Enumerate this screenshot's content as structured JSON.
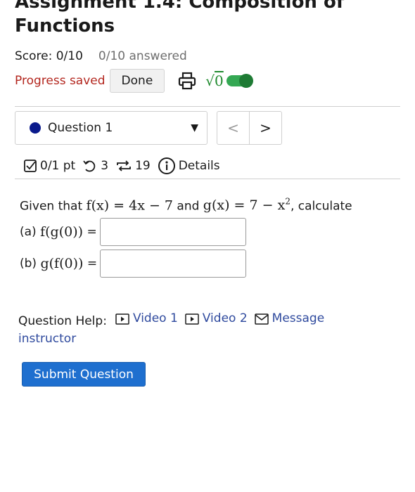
{
  "assignment": {
    "title": "Assignment 1.4: Composition of Functions"
  },
  "score": {
    "label": "Score: 0/10",
    "answered": "0/10 answered"
  },
  "save": {
    "status": "Progress saved",
    "done_label": "Done",
    "sqrt_glyph": "√",
    "sqrt_value": "0"
  },
  "question_nav": {
    "selected": "Question 1",
    "prev": "<",
    "next": ">"
  },
  "meta": {
    "points": "0/1 pt",
    "retries": "3",
    "attempts": "19",
    "details": "Details"
  },
  "question": {
    "intro": "Given that",
    "f_def": "f(x) = 4x − 7",
    "and": "and",
    "g_def": "g(x) = 7 − x",
    "g_exp": "2",
    "outro": ", calculate",
    "part_a_label": "(a)",
    "part_a_expr": "f(g(0))",
    "part_b_label": "(b)",
    "part_b_expr": "g(f(0))",
    "equals": "=",
    "part_a_value": "",
    "part_b_value": ""
  },
  "help": {
    "label": "Question Help:",
    "video1": "Video 1",
    "video2": "Video 2",
    "message_1": "Message",
    "message_2": "instructor"
  },
  "submit": {
    "label": "Submit Question"
  }
}
